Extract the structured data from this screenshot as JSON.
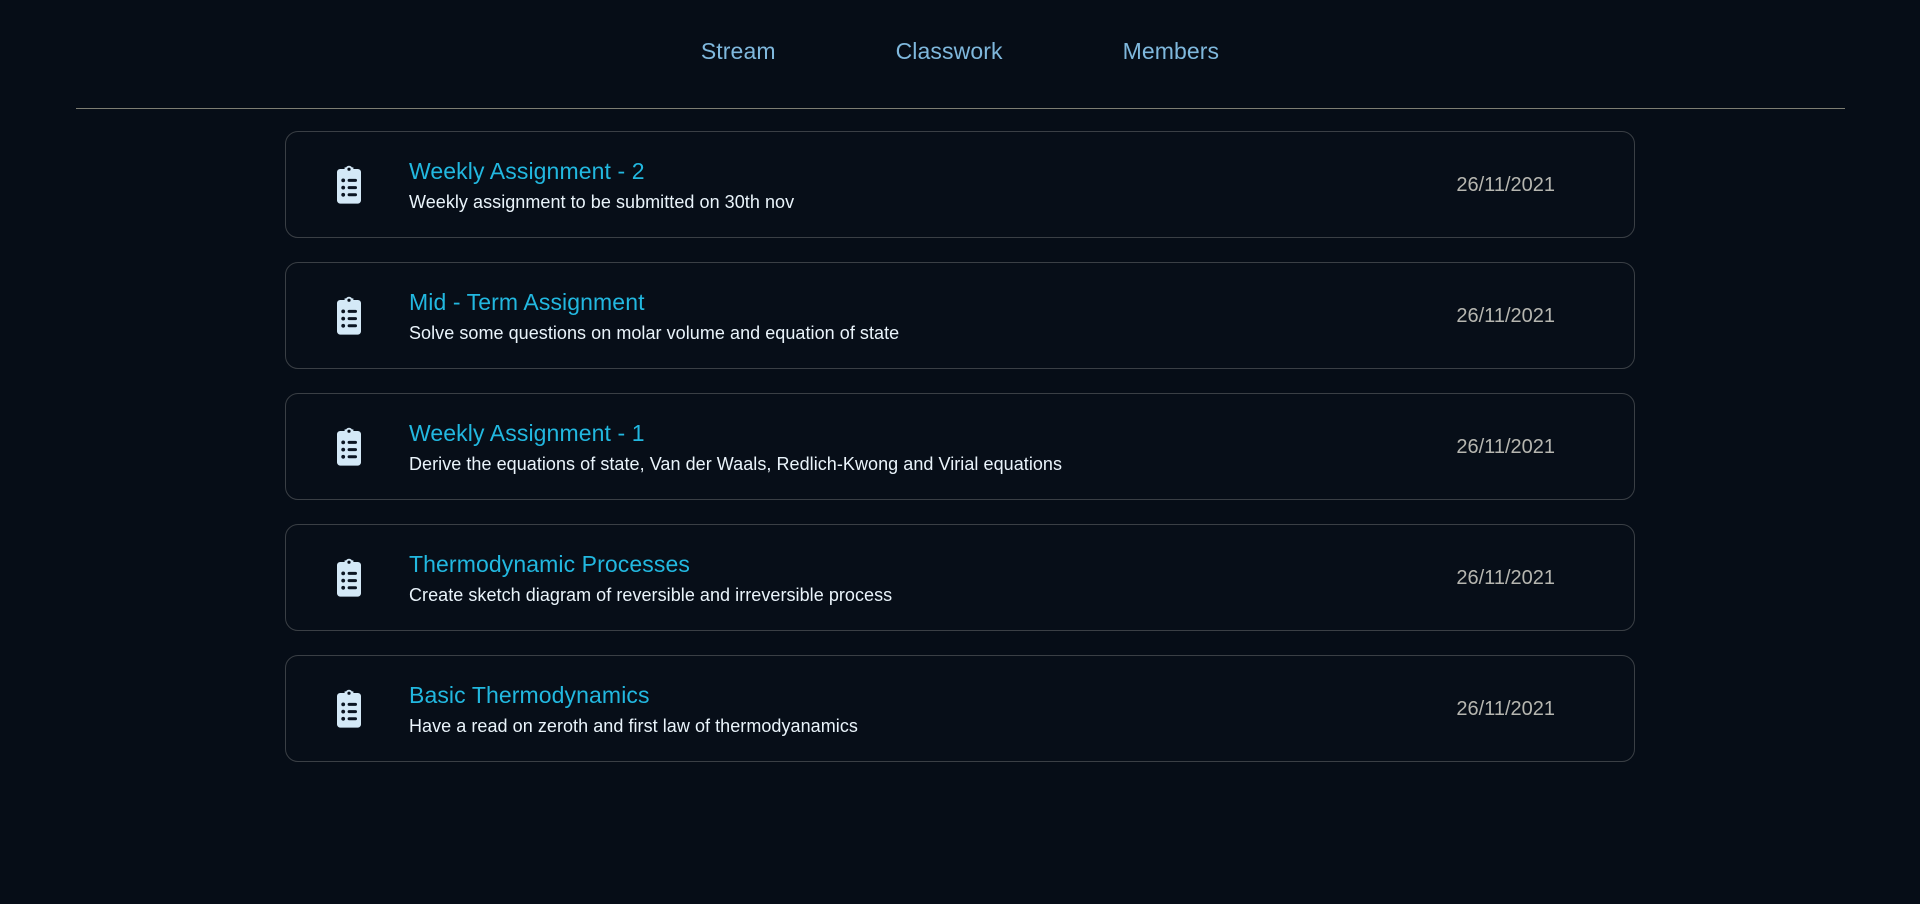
{
  "nav": {
    "tabs": [
      {
        "label": "Stream",
        "name": "tab-stream"
      },
      {
        "label": "Classwork",
        "name": "tab-classwork"
      },
      {
        "label": "Members",
        "name": "tab-members"
      }
    ],
    "active_color": "#7fb8dd"
  },
  "colors": {
    "background": "#060d17",
    "card_background": "#070e18",
    "card_border": "#3a3f45",
    "divider": "#7d7d72",
    "title": "#22b8e0",
    "description": "#eaf4fb",
    "date": "#b6b6b0",
    "icon": "#d4e9f7",
    "nav_tab": "#7fb8dd"
  },
  "main": {
    "assignments": [
      {
        "icon": "clipboard-list-icon",
        "title": "Weekly Assignment - 2",
        "description": "Weekly assignment to be submitted on 30th nov",
        "date": "26/11/2021"
      },
      {
        "icon": "clipboard-list-icon",
        "title": "Mid - Term Assignment",
        "description": "Solve some questions on molar volume and equation of state",
        "date": "26/11/2021"
      },
      {
        "icon": "clipboard-list-icon",
        "title": "Weekly Assignment - 1",
        "description": "Derive the equations of state, Van der Waals, Redlich-Kwong and Virial equations",
        "date": "26/11/2021"
      },
      {
        "icon": "clipboard-list-icon",
        "title": "Thermodynamic Processes",
        "description": "Create sketch diagram of reversible and irreversible process",
        "date": "26/11/2021"
      },
      {
        "icon": "clipboard-list-icon",
        "title": "Basic Thermodynamics",
        "description": "Have a read on zeroth and first law of thermodyanamics",
        "date": "26/11/2021"
      }
    ]
  }
}
